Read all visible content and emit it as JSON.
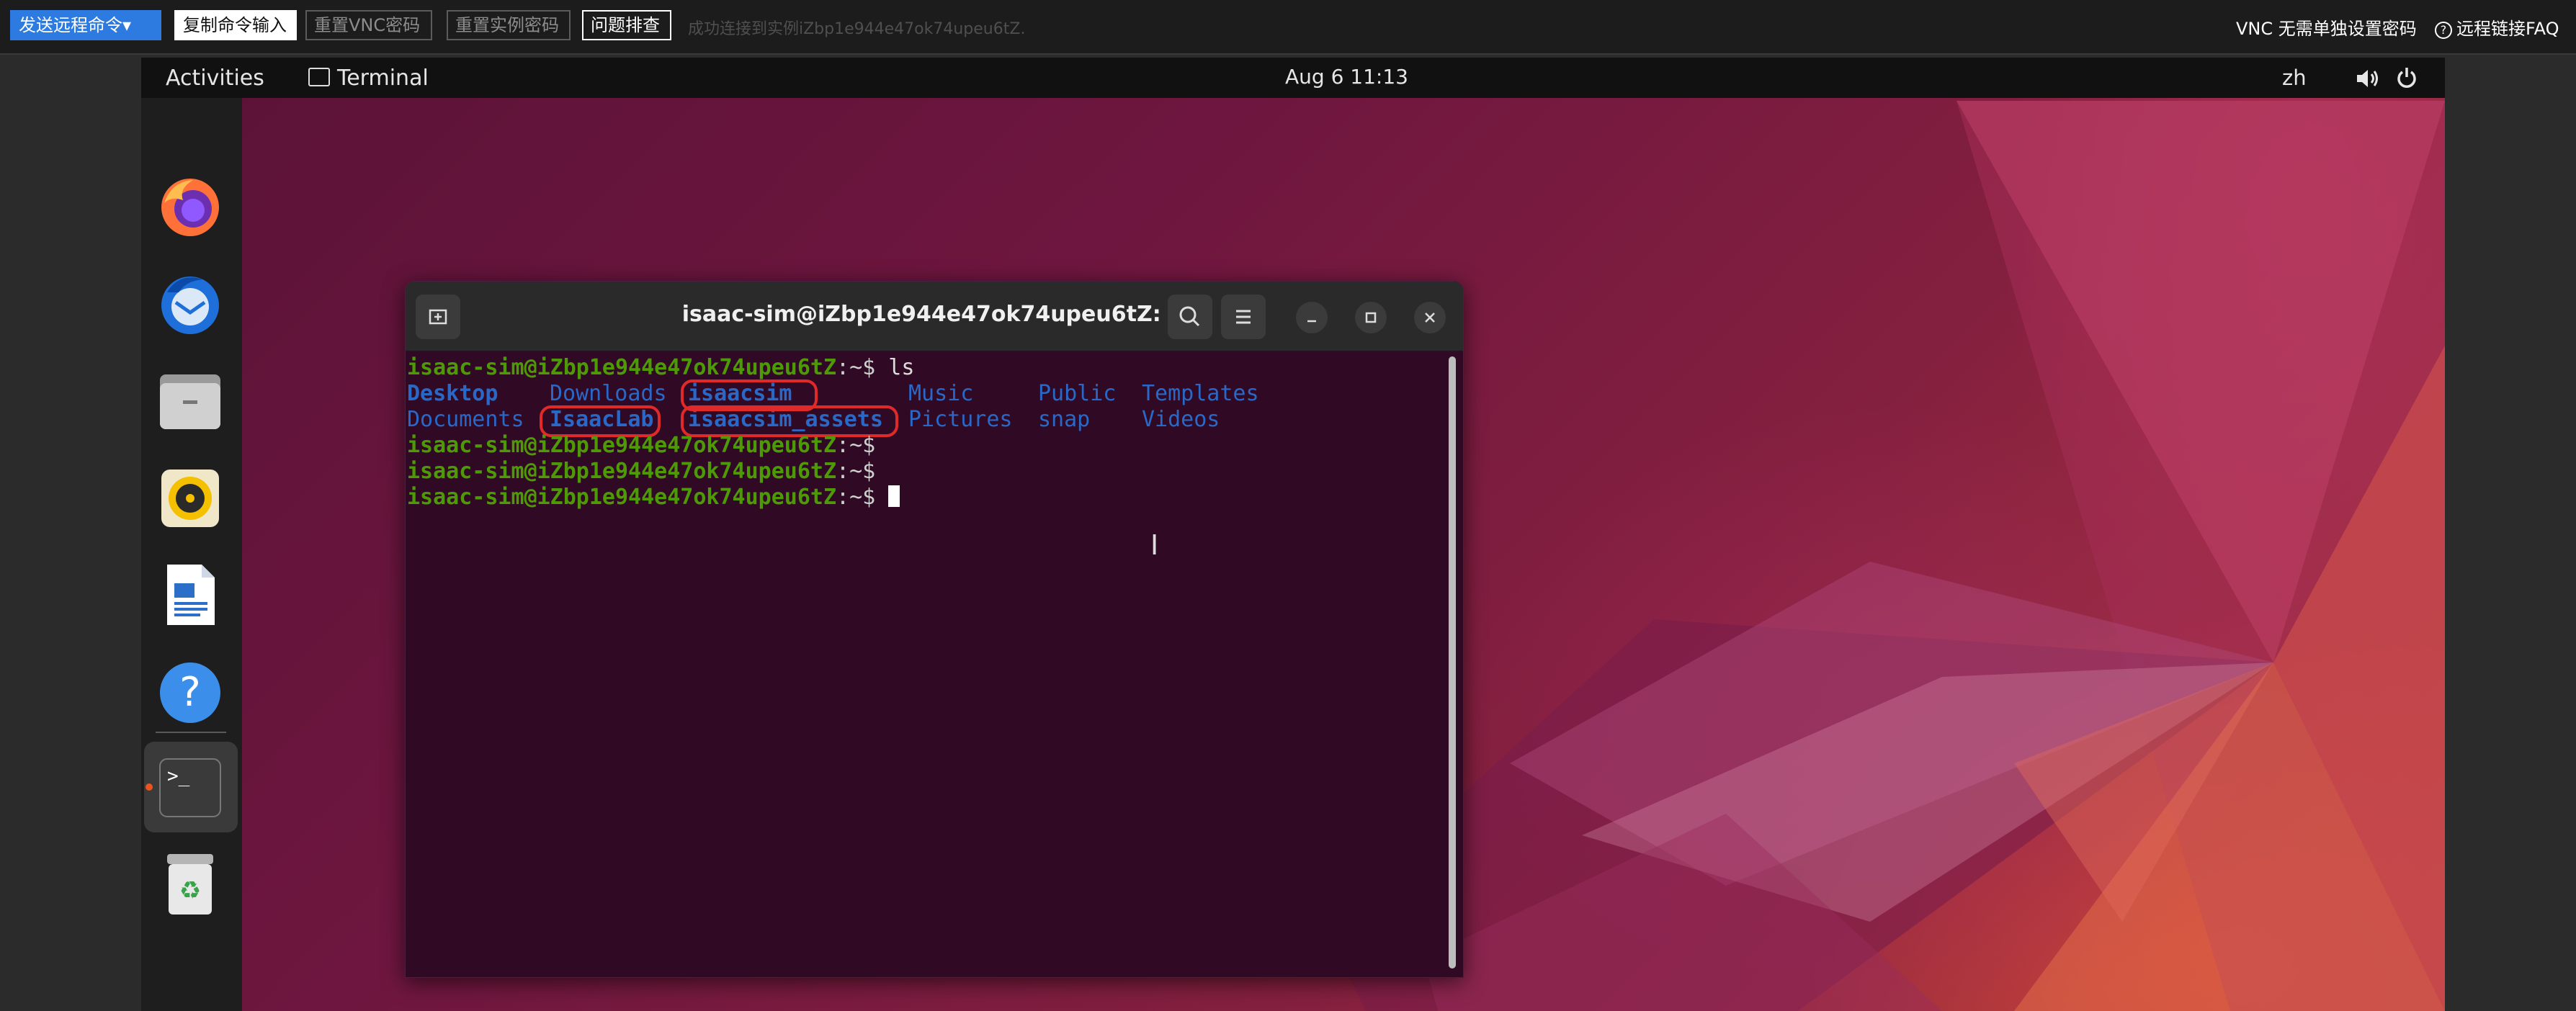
{
  "vnc_bar": {
    "send_cmd": "发送远程命令▾",
    "copy_input": "复制命令输入",
    "reset_vnc": "重置VNC密码",
    "reset_instance": "重置实例密码",
    "troubleshoot": "问题排查",
    "status": "成功连接到实例iZbp1e944e47ok74upeu6tZ.",
    "vnc_password_note": "VNC 无需单独设置密码",
    "faq": "远程链接FAQ",
    "colors": {
      "primary": "#2d7be0",
      "bar_bg": "#1c1c1c"
    }
  },
  "topbar": {
    "activities": "Activities",
    "app_name": "Terminal",
    "clock": "Aug 6  11:13",
    "lang": "zh",
    "icons": [
      "volume-icon",
      "power-icon"
    ]
  },
  "dock": {
    "items": [
      "firefox-icon",
      "thunderbird-icon",
      "files-icon",
      "rhythmbox-icon",
      "writer-icon",
      "help-icon",
      "terminal-icon",
      "trash-icon"
    ],
    "active": "terminal-icon",
    "accent": "#e95420"
  },
  "terminal": {
    "title": "isaac-sim@iZbp1e944e47ok74upeu6tZ: ~",
    "prompt": "isaac-sim@iZbp1e944e47ok74upeu6tZ",
    "prompt_path": ":~$",
    "command": " ls",
    "row1": [
      "Desktop",
      "Downloads",
      "isaacsim",
      "Music",
      "Public",
      "Templates"
    ],
    "row2": [
      "Documents",
      "IsaacLab",
      "isaacsim_assets",
      "Pictures",
      "snap",
      "Videos"
    ],
    "highlighted": [
      "isaacsim",
      "IsaacLab",
      "isaacsim_assets"
    ],
    "colors": {
      "bg": "#300a24",
      "prompt": "#4e9a06",
      "dir": "#2a68c8",
      "highlight": "#e02a2a"
    }
  }
}
